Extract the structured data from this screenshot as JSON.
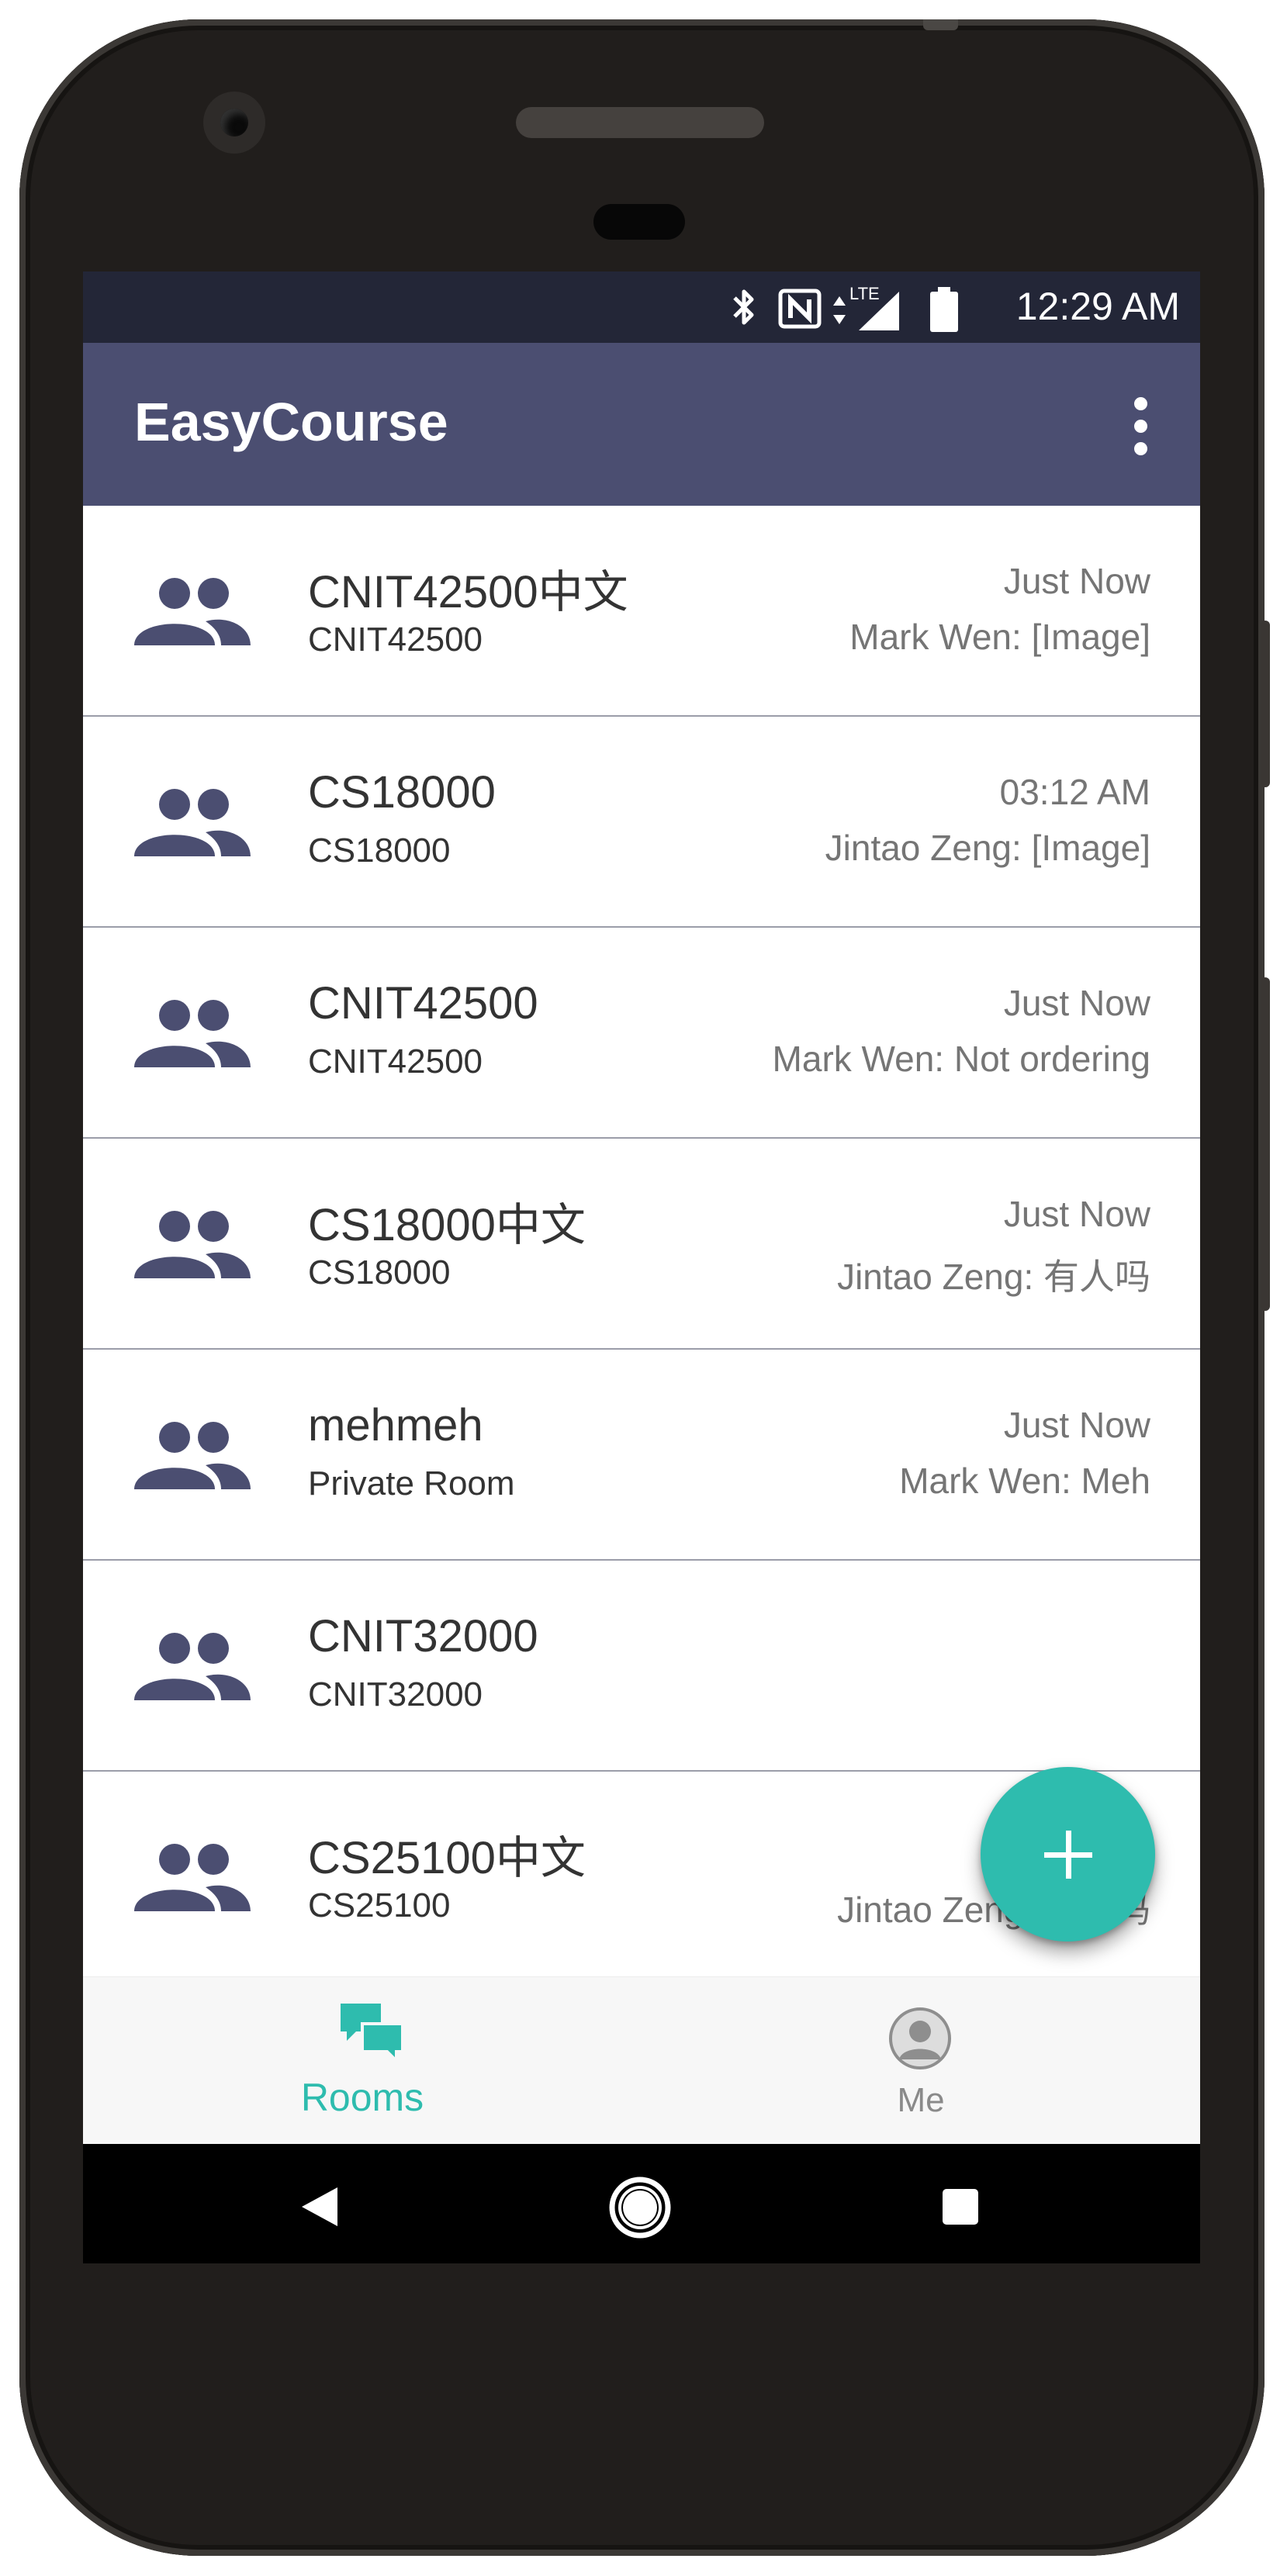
{
  "status_bar": {
    "time": "12:29 AM",
    "icons": [
      "bluetooth-icon",
      "nfc-icon",
      "lte-signal-icon",
      "battery-icon"
    ],
    "network_label": "LTE"
  },
  "app_bar": {
    "title": "EasyCourse",
    "menu_icon": "overflow-menu-icon"
  },
  "rooms": [
    {
      "name": "CNIT42500中文",
      "subtitle": "CNIT42500",
      "time": "Just Now",
      "last_message": "Mark Wen: [Image]"
    },
    {
      "name": "CS18000",
      "subtitle": "CS18000",
      "time": "03:12 AM",
      "last_message": "Jintao Zeng: [Image]"
    },
    {
      "name": "CNIT42500",
      "subtitle": "CNIT42500",
      "time": "Just Now",
      "last_message": "Mark Wen: Not ordering"
    },
    {
      "name": "CS18000中文",
      "subtitle": "CS18000",
      "time": "Just Now",
      "last_message": "Jintao Zeng: 有人吗"
    },
    {
      "name": "mehmeh",
      "subtitle": "Private Room",
      "time": "Just Now",
      "last_message": "Mark Wen: Meh"
    },
    {
      "name": "CNIT32000",
      "subtitle": "CNIT32000",
      "time": "",
      "last_message": ""
    },
    {
      "name": "CS25100中文",
      "subtitle": "CS25100",
      "time": "",
      "last_message": "Jintao Zeng: 有人吗"
    }
  ],
  "bottom_nav": {
    "items": [
      {
        "label": "Rooms",
        "icon": "chat-bubbles-icon",
        "active": true
      },
      {
        "label": "Me",
        "icon": "account-icon",
        "active": false
      }
    ]
  },
  "colors": {
    "status_bar": "#232637",
    "app_bar": "#4b4e71",
    "accent": "#2ebcae",
    "divider": "#9b9da9",
    "icon": "#4b4e71"
  }
}
